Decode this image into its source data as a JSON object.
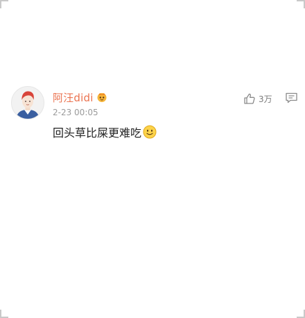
{
  "comment": {
    "username": "阿汪didi",
    "badge_icon": "vip-crown-icon",
    "timestamp": "2-23 00:05",
    "text": "回头草比屎更难吃",
    "emoji_icon": "smile-emoji-icon",
    "like_icon": "thumbs-up-icon",
    "like_count": "3万",
    "reply_icon": "comment-reply-icon"
  },
  "colors": {
    "username": "#eb7350",
    "timestamp": "#9a9a9a",
    "text": "#222222",
    "icon_gray": "#8a8a8a"
  }
}
